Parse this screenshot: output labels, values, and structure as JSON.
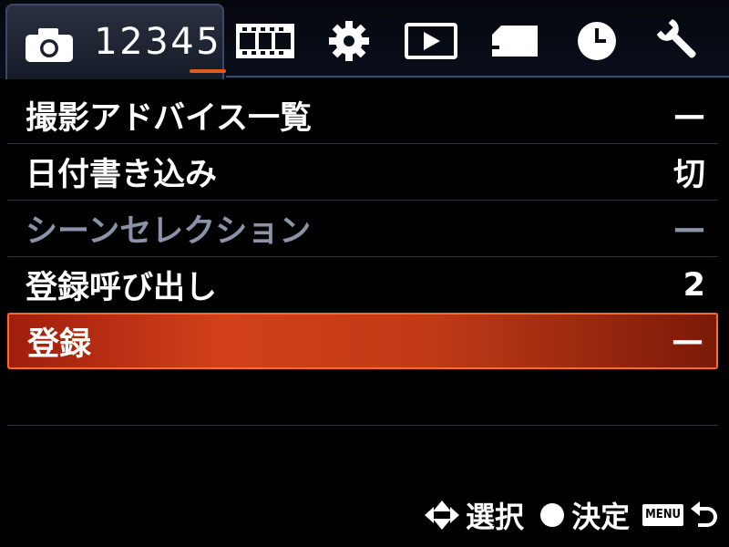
{
  "tabs": {
    "camera_pages": [
      "1",
      "2",
      "3",
      "4",
      "5"
    ],
    "current_page": "5",
    "icons": [
      "camera-icon",
      "movie-film-icon",
      "gear-icon",
      "playback-icon",
      "memory-card-icon",
      "clock-icon",
      "wrench-icon"
    ]
  },
  "menu": {
    "items": [
      {
        "label": "撮影アドバイス一覧",
        "value": "—",
        "state": "normal"
      },
      {
        "label": "日付書き込み",
        "value": "切",
        "state": "normal"
      },
      {
        "label": "シーンセレクション",
        "value": "—",
        "state": "disabled"
      },
      {
        "label": "登録呼び出し",
        "value": "2",
        "state": "normal"
      },
      {
        "label": "登録",
        "value": "—",
        "state": "selected"
      }
    ]
  },
  "guide": {
    "select_label": "選択",
    "confirm_label": "決定",
    "menu_button": "MENU"
  },
  "colors": {
    "accent": "#e05a20",
    "selected_row": "#c83a16",
    "tab_border": "#3a4a66",
    "disabled_text": "#8c93a8"
  }
}
